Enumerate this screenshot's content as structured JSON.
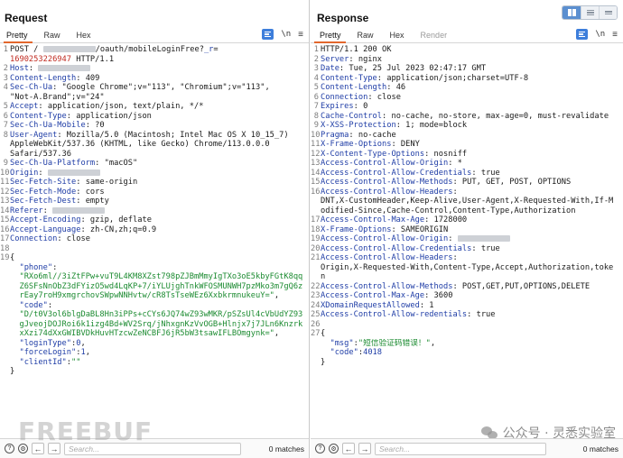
{
  "request": {
    "title": "Request",
    "tabs": [
      "Pretty",
      "Raw",
      "Hex"
    ],
    "tools": {
      "newline": "\\n",
      "menu": "≡"
    },
    "lines": [
      {
        "n": "1",
        "parts": [
          [
            "",
            "POST / "
          ],
          [
            "redact",
            ""
          ],
          [
            "",
            "/oauth/mobileLoginFree?"
          ],
          [
            "key",
            "_r"
          ],
          [
            "",
            "="
          ]
        ]
      },
      {
        "n": "",
        "parts": [
          [
            "red",
            "1690253226947"
          ],
          [
            "",
            " HTTP/1.1"
          ]
        ]
      },
      {
        "n": "2",
        "parts": [
          [
            "key",
            "Host"
          ],
          [
            "",
            ": "
          ],
          [
            "redact",
            ""
          ]
        ]
      },
      {
        "n": "3",
        "parts": [
          [
            "key",
            "Content-Length"
          ],
          [
            "",
            ": 409"
          ]
        ]
      },
      {
        "n": "4",
        "parts": [
          [
            "key",
            "Sec-Ch-Ua"
          ],
          [
            "",
            ": \"Google Chrome\";v=\"113\", \"Chromium\";v=\"113\","
          ]
        ]
      },
      {
        "n": "",
        "parts": [
          [
            "",
            "\"Not-A.Brand\";v=\"24\""
          ]
        ]
      },
      {
        "n": "5",
        "parts": [
          [
            "key",
            "Accept"
          ],
          [
            "",
            ": application/json, text/plain, */*"
          ]
        ]
      },
      {
        "n": "6",
        "parts": [
          [
            "key",
            "Content-Type"
          ],
          [
            "",
            ": application/json"
          ]
        ]
      },
      {
        "n": "7",
        "parts": [
          [
            "key",
            "Sec-Ch-Ua-Mobile"
          ],
          [
            "",
            ": ?0"
          ]
        ]
      },
      {
        "n": "8",
        "parts": [
          [
            "key",
            "User-Agent"
          ],
          [
            "",
            ": Mozilla/5.0 (Macintosh; Intel Mac OS X 10_15_7)"
          ]
        ]
      },
      {
        "n": "",
        "parts": [
          [
            "",
            "AppleWebKit/537.36 (KHTML, like Gecko) Chrome/113.0.0.0"
          ]
        ]
      },
      {
        "n": "",
        "parts": [
          [
            "",
            "Safari/537.36"
          ]
        ]
      },
      {
        "n": "9",
        "parts": [
          [
            "key",
            "Sec-Ch-Ua-Platform"
          ],
          [
            "",
            ": \"macOS\""
          ]
        ]
      },
      {
        "n": "10",
        "parts": [
          [
            "key",
            "Origin"
          ],
          [
            "",
            ": "
          ],
          [
            "redact",
            ""
          ]
        ]
      },
      {
        "n": "11",
        "parts": [
          [
            "key",
            "Sec-Fetch-Site"
          ],
          [
            "",
            ": same-origin"
          ]
        ]
      },
      {
        "n": "12",
        "parts": [
          [
            "key",
            "Sec-Fetch-Mode"
          ],
          [
            "",
            ": cors"
          ]
        ]
      },
      {
        "n": "13",
        "parts": [
          [
            "key",
            "Sec-Fetch-Dest"
          ],
          [
            "",
            ": empty"
          ]
        ]
      },
      {
        "n": "14",
        "parts": [
          [
            "key",
            "Referer"
          ],
          [
            "",
            ": "
          ],
          [
            "redact",
            ""
          ]
        ]
      },
      {
        "n": "15",
        "parts": [
          [
            "key",
            "Accept-Encoding"
          ],
          [
            "",
            ": gzip, deflate"
          ]
        ]
      },
      {
        "n": "16",
        "parts": [
          [
            "key",
            "Accept-Language"
          ],
          [
            "",
            ": zh-CN,zh;q=0.9"
          ]
        ]
      },
      {
        "n": "17",
        "parts": [
          [
            "key",
            "Connection"
          ],
          [
            "",
            ": close"
          ]
        ]
      },
      {
        "n": "18",
        "parts": []
      },
      {
        "n": "19",
        "parts": [
          [
            "brace",
            "{"
          ]
        ]
      },
      {
        "n": "",
        "parts": [
          [
            "",
            "  "
          ],
          [
            "key",
            "\"phone\""
          ],
          [
            "",
            ":"
          ]
        ]
      },
      {
        "n": "",
        "parts": [
          [
            "",
            "  "
          ],
          [
            "str",
            "\"RXo6ml//3iZtFPw+vuT9L4KM8XZst798pZJBmMmyIgTXo3oE5kbyFGtK8qq"
          ]
        ]
      },
      {
        "n": "",
        "parts": [
          [
            "",
            "  "
          ],
          [
            "str",
            "Z6SFsNnObZ3dFYizO5wd4LqKP+7/iYLUjghTnkWFOSMUNWH7pzMko3m7gQ6z"
          ]
        ]
      },
      {
        "n": "",
        "parts": [
          [
            "",
            "  "
          ],
          [
            "str",
            "rEay7roH9xmgrchovSWpwNNHvtw/cR8TsTseWEz6XxbkrmnukeuY=\""
          ],
          [
            "",
            ","
          ]
        ]
      },
      {
        "n": "",
        "parts": [
          [
            "",
            "  "
          ],
          [
            "key",
            "\"code\""
          ],
          [
            "",
            ":"
          ]
        ]
      },
      {
        "n": "",
        "parts": [
          [
            "",
            "  "
          ],
          [
            "str",
            "\"D/t0V3ol6blgDaBL8Hn3iPPs+cCYs6JQ74wZ93wMKR/pSZsUl4cVbUdYZ93"
          ]
        ]
      },
      {
        "n": "",
        "parts": [
          [
            "",
            "  "
          ],
          [
            "str",
            "gJveojDOJRoi6k1izg4Bd+WV2Srq/jNhxgnKzVvOGB+Hlnjx7j7JLn6Knzrk"
          ]
        ]
      },
      {
        "n": "",
        "parts": [
          [
            "",
            "  "
          ],
          [
            "str",
            "xXzi74dXxGWIBVDkHuvHTzcwZeNCBFJ6jR5bW3tsawIFLBOmgynk=\""
          ],
          [
            "",
            ","
          ]
        ]
      },
      {
        "n": "",
        "parts": [
          [
            "",
            "  "
          ],
          [
            "key",
            "\"loginType\""
          ],
          [
            "",
            ":"
          ],
          [
            "num",
            "0"
          ],
          [
            "",
            ","
          ]
        ]
      },
      {
        "n": "",
        "parts": [
          [
            "",
            "  "
          ],
          [
            "key",
            "\"forceLogin\""
          ],
          [
            "",
            ":"
          ],
          [
            "num",
            "1"
          ],
          [
            "",
            ","
          ]
        ]
      },
      {
        "n": "",
        "parts": [
          [
            "",
            "  "
          ],
          [
            "key",
            "\"clientId\""
          ],
          [
            "",
            ":"
          ],
          [
            "str",
            "\"\""
          ]
        ]
      },
      {
        "n": "",
        "parts": [
          [
            "brace",
            "}"
          ]
        ]
      }
    ],
    "search_placeholder": "Search...",
    "matches": "0 matches"
  },
  "response": {
    "title": "Response",
    "tabs": [
      "Pretty",
      "Raw",
      "Hex",
      "Render"
    ],
    "tools": {
      "newline": "\\n",
      "menu": "≡"
    },
    "lines": [
      {
        "n": "1",
        "parts": [
          [
            "",
            "HTTP/1.1 200 OK"
          ]
        ]
      },
      {
        "n": "2",
        "parts": [
          [
            "key",
            "Server"
          ],
          [
            "",
            ": nginx"
          ]
        ]
      },
      {
        "n": "3",
        "parts": [
          [
            "key",
            "Date"
          ],
          [
            "",
            ": Tue, 25 Jul 2023 02:47:17 GMT"
          ]
        ]
      },
      {
        "n": "4",
        "parts": [
          [
            "key",
            "Content-Type"
          ],
          [
            "",
            ": application/json;charset=UTF-8"
          ]
        ]
      },
      {
        "n": "5",
        "parts": [
          [
            "key",
            "Content-Length"
          ],
          [
            "",
            ": 46"
          ]
        ]
      },
      {
        "n": "6",
        "parts": [
          [
            "key",
            "Connection"
          ],
          [
            "",
            ": close"
          ]
        ]
      },
      {
        "n": "7",
        "parts": [
          [
            "key",
            "Expires"
          ],
          [
            "",
            ": 0"
          ]
        ]
      },
      {
        "n": "8",
        "parts": [
          [
            "key",
            "Cache-Control"
          ],
          [
            "",
            ": no-cache, no-store, max-age=0, must-revalidate"
          ]
        ]
      },
      {
        "n": "9",
        "parts": [
          [
            "key",
            "X-XSS-Protection"
          ],
          [
            "",
            ": 1; mode=block"
          ]
        ]
      },
      {
        "n": "10",
        "parts": [
          [
            "key",
            "Pragma"
          ],
          [
            "",
            ": no-cache"
          ]
        ]
      },
      {
        "n": "11",
        "parts": [
          [
            "key",
            "X-Frame-Options"
          ],
          [
            "",
            ": DENY"
          ]
        ]
      },
      {
        "n": "12",
        "parts": [
          [
            "key",
            "X-Content-Type-Options"
          ],
          [
            "",
            ": nosniff"
          ]
        ]
      },
      {
        "n": "13",
        "parts": [
          [
            "key",
            "Access-Control-Allow-Origin"
          ],
          [
            "",
            ": *"
          ]
        ]
      },
      {
        "n": "14",
        "parts": [
          [
            "key",
            "Access-Control-Allow-Credentials"
          ],
          [
            "",
            ": true"
          ]
        ]
      },
      {
        "n": "15",
        "parts": [
          [
            "key",
            "Access-Control-Allow-Methods"
          ],
          [
            "",
            ": PUT, GET, POST, OPTIONS"
          ]
        ]
      },
      {
        "n": "16",
        "parts": [
          [
            "key",
            "Access-Control-Allow-Headers"
          ],
          [
            "",
            ":"
          ]
        ]
      },
      {
        "n": "",
        "parts": [
          [
            "",
            "DNT,X-CustomHeader,Keep-Alive,User-Agent,X-Requested-With,If-M"
          ]
        ]
      },
      {
        "n": "",
        "parts": [
          [
            "",
            "odified-Since,Cache-Control,Content-Type,Authorization"
          ]
        ]
      },
      {
        "n": "17",
        "parts": [
          [
            "key",
            "Access-Control-Max-Age"
          ],
          [
            "",
            ": 1728000"
          ]
        ]
      },
      {
        "n": "18",
        "parts": [
          [
            "key",
            "X-Frame-Options"
          ],
          [
            "",
            ": SAMEORIGIN"
          ]
        ]
      },
      {
        "n": "19",
        "parts": [
          [
            "key",
            "Access-Control-Allow-Origin"
          ],
          [
            "",
            ": "
          ],
          [
            "redact",
            ""
          ]
        ]
      },
      {
        "n": "20",
        "parts": [
          [
            "key",
            "Access-Control-Allow-Credentials"
          ],
          [
            "",
            ": true"
          ]
        ]
      },
      {
        "n": "21",
        "parts": [
          [
            "key",
            "Access-Control-Allow-Headers"
          ],
          [
            "",
            ":"
          ]
        ]
      },
      {
        "n": "",
        "parts": [
          [
            "",
            "Origin,X-Requested-With,Content-Type,Accept,Authorization,toke"
          ]
        ]
      },
      {
        "n": "",
        "parts": [
          [
            "",
            "n"
          ]
        ]
      },
      {
        "n": "22",
        "parts": [
          [
            "key",
            "Access-Control-Allow-Methods"
          ],
          [
            "",
            ": POST,GET,PUT,OPTIONS,DELETE"
          ]
        ]
      },
      {
        "n": "23",
        "parts": [
          [
            "key",
            "Access-Control-Max-Age"
          ],
          [
            "",
            ": 3600"
          ]
        ]
      },
      {
        "n": "24",
        "parts": [
          [
            "key",
            "XDomainRequestAllowed"
          ],
          [
            "",
            ": 1"
          ]
        ]
      },
      {
        "n": "25",
        "parts": [
          [
            "key",
            "Access-Control-Allow-redentials"
          ],
          [
            "",
            ": true"
          ]
        ]
      },
      {
        "n": "26",
        "parts": []
      },
      {
        "n": "27",
        "parts": [
          [
            "brace",
            "{"
          ]
        ]
      },
      {
        "n": "",
        "parts": [
          [
            "",
            "  "
          ],
          [
            "key",
            "\"msg\""
          ],
          [
            "",
            ":"
          ],
          [
            "str",
            "\"短信验证码错误！\""
          ],
          [
            "",
            ","
          ]
        ]
      },
      {
        "n": "",
        "parts": [
          [
            "",
            "  "
          ],
          [
            "key",
            "\"code\""
          ],
          [
            "",
            ":"
          ],
          [
            "num",
            "4018"
          ]
        ]
      },
      {
        "n": "",
        "parts": [
          [
            "brace",
            "}"
          ]
        ]
      }
    ],
    "search_placeholder": "Search...",
    "matches": "0 matches"
  },
  "overlay": {
    "watermark": "FREEBUF",
    "wechat_label": "公众号 · 灵悉实验室"
  },
  "colors": {
    "accent_tab": "#e2672d",
    "key": "#1f3da6",
    "string": "#1c8b31",
    "number_red": "#c02a20",
    "toggle_active": "#5b8fd0"
  },
  "icons": [
    "layout-split-icon",
    "layout-rows-icon",
    "layout-single-icon",
    "wrap-icon",
    "help-icon",
    "settings-icon",
    "back-arrow-icon",
    "forward-arrow-icon",
    "wechat-icon"
  ]
}
